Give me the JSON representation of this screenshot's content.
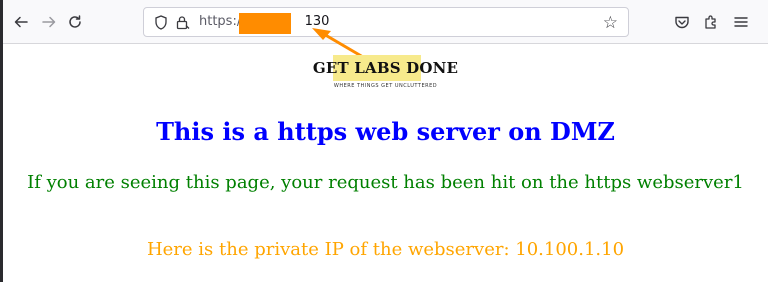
{
  "browser": {
    "url_prefix": "https://",
    "url_suffix": "130"
  },
  "page": {
    "logo_title": "GET LABS DONE",
    "logo_tagline": "WHERE THINGS GET UNCLUTTERED",
    "heading": "This is a https web server on DMZ",
    "message": "If you are seeing this page, your request has been hit on the https webserver1",
    "ip_line": "Here is the private IP of the webserver: 10.100.1.10"
  },
  "colors": {
    "heading": "#0000ff",
    "message": "#008000",
    "ip_line": "#ffa500",
    "annotation": "#ff8c00"
  }
}
